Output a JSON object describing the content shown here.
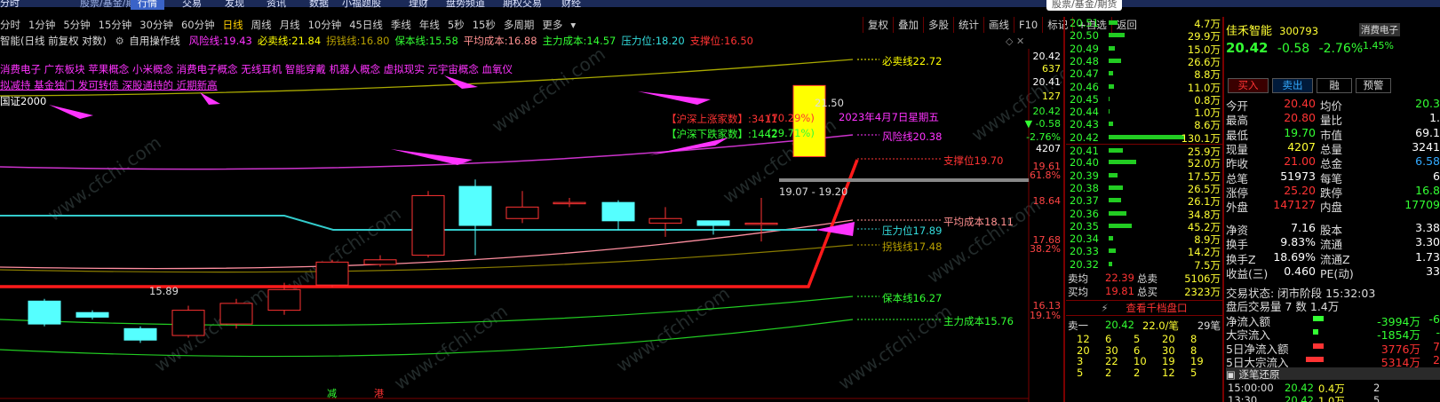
{
  "top_nav": {
    "tabs": [
      "分时",
      "行情",
      "交易",
      "发现",
      "资讯",
      "数据",
      "小福题股",
      "理财",
      "盘势频道",
      "期权交易",
      "财经"
    ],
    "search_text": "股票/基金/期货",
    "active_tab": "行情"
  },
  "periods": {
    "items": [
      "分时",
      "1分钟",
      "5分钟",
      "15分钟",
      "30分钟",
      "60分钟",
      "日线",
      "周线",
      "月线",
      "10分钟",
      "45日线",
      "季线",
      "年线",
      "5秒",
      "15秒",
      "多周期",
      "更多"
    ],
    "selected": "日线"
  },
  "toolbar": [
    "复权",
    "叠加",
    "多股",
    "统计",
    "画线",
    "F10",
    "标记",
    "+自选",
    "返回"
  ],
  "indicator_header": {
    "name": "智能(日线 前复权 对数)",
    "tool": "自用操作线",
    "items": [
      {
        "label": "风险线:",
        "value": "19.43",
        "color": "#ff33ff"
      },
      {
        "label": "必卖线:",
        "value": "21.84",
        "color": "#ffff00"
      },
      {
        "label": "拐钱线:",
        "value": "16.80",
        "color": "#b8a000"
      },
      {
        "label": "保本线:",
        "value": "15.58",
        "color": "#33ff33"
      },
      {
        "label": "平均成本:",
        "value": "16.88",
        "color": "#ff9090"
      },
      {
        "label": "主力成本:",
        "value": "14.57",
        "color": "#33ff33"
      },
      {
        "label": "压力位:",
        "value": "18.20",
        "color": "#33dddd"
      },
      {
        "label": "支撑位:",
        "value": "16.50",
        "color": "#ff3333"
      }
    ]
  },
  "chart": {
    "concepts_line1": "消费电子 广东板块 苹果概念 小米概念 消费电子概念 无线耳机 智能穿戴 机器人概念 虚拟现实 元宇宙概念 血氧仪",
    "concepts_line2": "拟减持 基金独门 发可转债 深股通持的 近期新高",
    "index_note": "国证2000",
    "up_count": "【沪深上涨家数】:3411",
    "up_pct": "(70.29%)",
    "down_count": "【沪深下跌家数】:1442",
    "down_pct": "(29.71%)",
    "date_label": "2023年4月7日星期五",
    "high_mark": "21.50",
    "low_mark": "15.89",
    "range_label": "19.07 - 19.20",
    "lines": {
      "risk": "风险线20.38",
      "sell": "必卖线22.72",
      "support": "支撑位19.70",
      "avg_cost": "平均成本18.11",
      "pressure": "压力位17.89",
      "turn": "拐钱线17.48",
      "guarantee": "保本线16.27",
      "main_cost": "主力成本15.76"
    },
    "bottom_marks": [
      "减",
      "港"
    ],
    "watermark": "www.cfchi.com"
  },
  "right_axis": [
    {
      "t": "20.42",
      "c": "#ffffff"
    },
    {
      "t": "637",
      "c": "#ffff33"
    },
    {
      "t": "20.41",
      "c": "#ffffff"
    },
    {
      "t": "127",
      "c": "#ffff33"
    },
    {
      "t": "20.42",
      "c": "#33ff33"
    },
    {
      "t": "▼ -0.58",
      "c": "#33ff33"
    },
    {
      "t": "-2.76%",
      "c": "#33ff33"
    },
    {
      "t": "4207",
      "c": "#ffffff"
    },
    {
      "t": "19.61",
      "c": "#ff4444"
    },
    {
      "t": "61.8%",
      "c": "#ff4444"
    },
    {
      "t": "18.64",
      "c": "#ff4444"
    },
    {
      "t": "17.68",
      "c": "#ff4444"
    },
    {
      "t": "38.2%",
      "c": "#ff4444"
    },
    {
      "t": "16.13",
      "c": "#ff4444"
    },
    {
      "t": "19.1%",
      "c": "#ff4444"
    }
  ],
  "chart_data": {
    "type": "candlestick",
    "candles": [
      {
        "o": 16.8,
        "c": 16.3,
        "h": 16.85,
        "l": 16.25
      },
      {
        "o": 16.55,
        "c": 16.45,
        "h": 16.6,
        "l": 16.4
      },
      {
        "o": 16.2,
        "c": 15.95,
        "h": 16.25,
        "l": 15.89
      },
      {
        "o": 16.05,
        "c": 16.6,
        "h": 16.7,
        "l": 16.0
      },
      {
        "o": 16.3,
        "c": 16.75,
        "h": 16.85,
        "l": 16.2
      },
      {
        "o": 16.6,
        "c": 17.05,
        "h": 17.2,
        "l": 16.5
      },
      {
        "o": 17.15,
        "c": 17.65,
        "h": 17.7,
        "l": 17.1
      },
      {
        "o": 17.6,
        "c": 17.7,
        "h": 17.8,
        "l": 17.55
      },
      {
        "o": 17.8,
        "c": 19.1,
        "h": 19.2,
        "l": 17.75
      },
      {
        "o": 19.3,
        "c": 18.45,
        "h": 19.45,
        "l": 17.8
      },
      {
        "o": 18.6,
        "c": 18.85,
        "h": 19.2,
        "l": 18.5
      },
      {
        "o": 18.95,
        "c": 18.95,
        "h": 19.05,
        "l": 18.85
      },
      {
        "o": 18.95,
        "c": 18.55,
        "h": 19.0,
        "l": 18.35
      },
      {
        "o": 18.5,
        "c": 18.6,
        "h": 18.85,
        "l": 18.2
      },
      {
        "o": 18.55,
        "c": 18.45,
        "h": 18.55,
        "l": 18.25
      },
      {
        "o": 18.5,
        "c": 18.5,
        "h": 19.05,
        "l": 18.1
      },
      {
        "o": 19.95,
        "c": 21.5,
        "h": 21.5,
        "l": 19.95
      }
    ]
  },
  "order_book": [
    {
      "p": "20.51",
      "v": "4.7万",
      "w": 8
    },
    {
      "p": "20.50",
      "v": "29.9万",
      "w": 15
    },
    {
      "p": "20.49",
      "v": "15.0万",
      "w": 6
    },
    {
      "p": "20.48",
      "v": "26.6万",
      "w": 12
    },
    {
      "p": "20.47",
      "v": "8.8万",
      "w": 4
    },
    {
      "p": "20.46",
      "v": "11.0万",
      "w": 5
    },
    {
      "p": "20.45",
      "v": "0.8万",
      "w": 1
    },
    {
      "p": "20.44",
      "v": "1.0万",
      "w": 1
    },
    {
      "p": "20.43",
      "v": "8.6万",
      "w": 4
    },
    {
      "p": "20.42",
      "v": "130.1万",
      "w": 72
    },
    {
      "p": "20.41",
      "v": "25.9万",
      "w": 13
    },
    {
      "p": "20.40",
      "v": "52.0万",
      "w": 26
    },
    {
      "p": "20.39",
      "v": "17.5万",
      "w": 8
    },
    {
      "p": "20.38",
      "v": "26.5万",
      "w": 13
    },
    {
      "p": "20.37",
      "v": "26.1万",
      "w": 12
    },
    {
      "p": "20.36",
      "v": "34.8万",
      "w": 17
    },
    {
      "p": "20.35",
      "v": "45.2万",
      "w": 22
    },
    {
      "p": "20.34",
      "v": "8.9万",
      "w": 4
    },
    {
      "p": "20.33",
      "v": "14.2万",
      "w": 7
    },
    {
      "p": "20.32",
      "v": "7.5万",
      "w": 3
    }
  ],
  "book_summary": {
    "sell_avg_label": "卖均",
    "sell_avg": "22.39",
    "sell_total_label": "总卖",
    "sell_total": "5106万",
    "buy_avg_label": "买均",
    "buy_avg": "19.81",
    "buy_total_label": "总买",
    "buy_total": "2323万",
    "ten_level": "查看千档盘口",
    "ask1_label": "卖一",
    "ask1_price": "20.42",
    "ask1_qty": "22.0/笔",
    "ask1_count": "29笔",
    "queue": [
      [
        "12",
        "6",
        "5",
        "20",
        "8"
      ],
      [
        "20",
        "30",
        "6",
        "30",
        "8"
      ],
      [
        "3",
        "22",
        "10",
        "19",
        "19"
      ],
      [
        "5",
        "2",
        "2",
        "12",
        "5"
      ]
    ]
  },
  "stock": {
    "name": "佳禾智能",
    "code": "300793",
    "sector": "消费电子",
    "price": "20.42",
    "change": "-0.58",
    "change_pct": "-2.76%",
    "sector_pct": "-1.45%",
    "buttons": [
      "买入",
      "卖出",
      "融",
      "预警"
    ],
    "stats": [
      [
        "今开",
        "20.40",
        "均价",
        "20.3"
      ],
      [
        "最高",
        "20.80",
        "量比",
        "1."
      ],
      [
        "最低",
        "19.70",
        "市值",
        "69.1"
      ],
      [
        "现量",
        "4207",
        "总量",
        "3241"
      ],
      [
        "昨收",
        "21.00",
        "总金",
        "6.58"
      ],
      [
        "总笔",
        "51973",
        "每笔",
        "6"
      ],
      [
        "涨停",
        "25.20",
        "跌停",
        "16.8"
      ],
      [
        "外盘",
        "147127",
        "内盘",
        "17709"
      ]
    ],
    "stats2": [
      [
        "净资",
        "7.16",
        "股本",
        "3.38"
      ],
      [
        "换手",
        "9.83%",
        "流通",
        "3.30"
      ],
      [
        "换手Z",
        "18.69%",
        "流通Z",
        "1.73"
      ],
      [
        "收益(三)",
        "0.460",
        "PE(动)",
        "33"
      ]
    ],
    "trade_status": "交易状态: 闭市阶段 15:32:03",
    "after_hours": "盘后交易量 7 数 1.4万",
    "flows": [
      {
        "label": "净流入额",
        "value": "-3994万",
        "tail": "-6",
        "color": "#33ff33",
        "bar": 12
      },
      {
        "label": "大宗流入",
        "value": "-1854万",
        "tail": "-",
        "color": "#33ff33",
        "bar": 6
      },
      {
        "label": "5日净流入额",
        "value": "3776万",
        "tail": "7",
        "color": "#ff3333",
        "bar": 12
      },
      {
        "label": "5日大宗流入",
        "value": "5314万",
        "tail": "2",
        "color": "#ff3333",
        "bar": 20
      }
    ],
    "ticks_title": "逐笔还原",
    "ticks": [
      [
        "15:00:00",
        "20.42",
        "0.4万",
        "2"
      ],
      [
        "13:30",
        "20.42",
        "1.0万",
        "5"
      ]
    ]
  }
}
